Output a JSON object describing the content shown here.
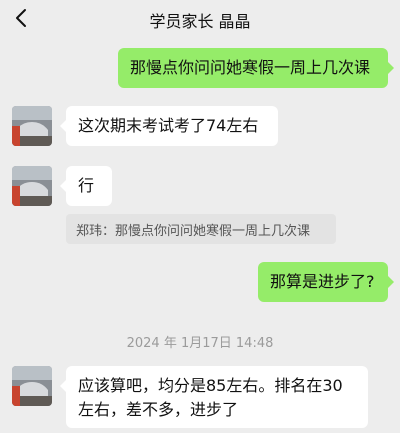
{
  "header": {
    "title": "学员家长 晶晶",
    "back_icon": "chevron-left-icon"
  },
  "messages": [
    {
      "side": "right",
      "text": "那慢点你问问她寒假一周上几次课"
    },
    {
      "side": "left",
      "text": "这次期末考试考了74左右"
    },
    {
      "side": "left",
      "text": "行"
    },
    {
      "side": "quote",
      "text": "郑玮：那慢点你问问她寒假一周上几次课"
    },
    {
      "side": "right",
      "text": "那算是进步了?"
    },
    {
      "side": "left",
      "text": "应该算吧，均分是85左右。排名在30左右，差不多，进步了"
    }
  ],
  "timestamp": "2024 年 1月17日 14:48",
  "colors": {
    "background": "#ededed",
    "right_bubble": "#95ec69",
    "left_bubble": "#ffffff"
  }
}
